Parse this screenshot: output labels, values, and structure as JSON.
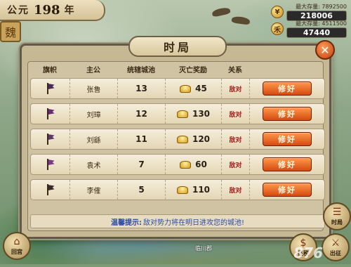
{
  "top_left": {
    "prefix": "公元",
    "year": "198",
    "suffix": "年",
    "seal_glyph": "魏"
  },
  "resources": [
    {
      "icon": "coin-icon",
      "caption": "最大存量: 7892500",
      "value": "218006"
    },
    {
      "icon": "grain-icon",
      "caption": "最大存量: 4511500",
      "value": "47440"
    }
  ],
  "dialog": {
    "title": "时局",
    "close_glyph": "✕",
    "headers": [
      "旗帜",
      "主公",
      "统辖城池",
      "灭亡奖励",
      "关系"
    ],
    "rows": [
      {
        "lord": "张鲁",
        "cities": "13",
        "reward": "45",
        "relation": "敌对",
        "action": "修好",
        "flag_color": "#4a2a5a"
      },
      {
        "lord": "刘璋",
        "cities": "12",
        "reward": "130",
        "relation": "敌对",
        "action": "修好",
        "flag_color": "#6a2a7a"
      },
      {
        "lord": "刘繇",
        "cities": "11",
        "reward": "120",
        "relation": "敌对",
        "action": "修好",
        "flag_color": "#5a3a6a"
      },
      {
        "lord": "袁术",
        "cities": "7",
        "reward": "60",
        "relation": "敌对",
        "action": "修好",
        "flag_color": "#7a3a8a"
      },
      {
        "lord": "李傕",
        "cities": "5",
        "reward": "110",
        "relation": "敌对",
        "action": "修好",
        "flag_color": "#3a2a2a"
      }
    ],
    "tip_label": "温馨提示:",
    "tip_text": "敌对势力将在明日进攻您的城池!"
  },
  "bottom": {
    "left_button": "回宫",
    "right_top_button": "时局",
    "right_bottom_left": "征税",
    "right_bottom_right": "出征",
    "town_label": "临川郡",
    "watermark": "876"
  }
}
